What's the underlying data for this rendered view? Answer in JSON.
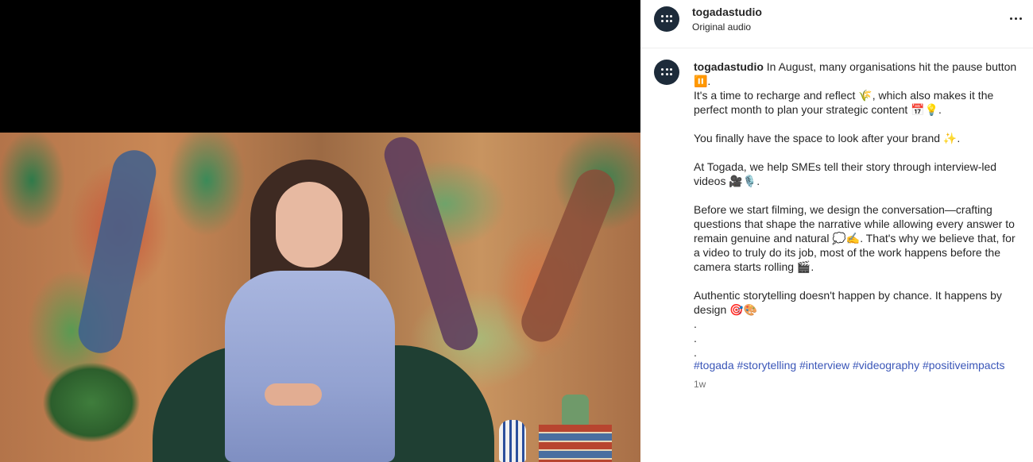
{
  "header": {
    "username": "togadastudio",
    "subtitle": "Original audio",
    "more_icon": "more-horizontal-icon"
  },
  "caption": {
    "username": "togadastudio",
    "text": "In August, many organisations hit the pause button ⏸️.\nIt's a time to recharge and reflect 🌾, which also makes it the perfect month to plan your strategic content 📅💡.\n\nYou finally have the space to look after your brand ✨.\n\nAt Togada, we help SMEs tell their story through interview-led videos 🎥🎙️.\n\nBefore we start filming, we design the conversation—crafting questions that shape the narrative while allowing every answer to remain genuine and natural 💭✍️. That's why we believe that, for a video to truly do its job, most of the work happens before the camera starts rolling 🎬.\n\nAuthentic storytelling doesn't happen by chance. It happens by design 🎯🎨\n.\n.\n.",
    "hashtags": [
      "#togada",
      "#storytelling",
      "#interview",
      "#videography",
      "#positiveimpacts"
    ],
    "timestamp": "1w"
  },
  "colors": {
    "media_background": "#000000",
    "avatar_background": "#1d2b3a",
    "hashtag": "#3a56b8",
    "timestamp": "#737373"
  }
}
